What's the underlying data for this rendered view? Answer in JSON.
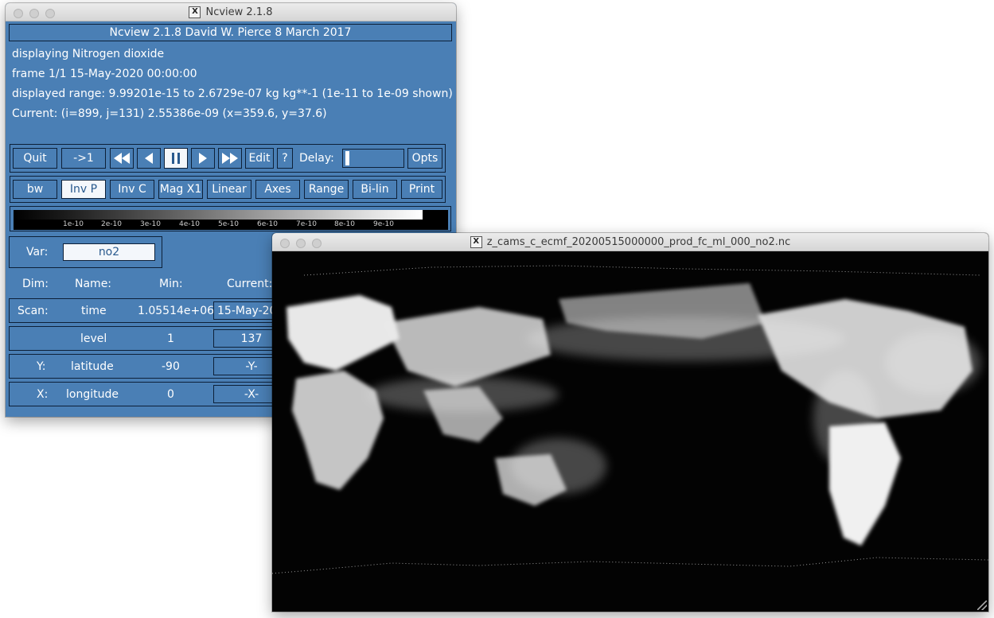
{
  "ncview_window": {
    "title": "Ncview 2.1.8",
    "header": "Ncview 2.1.8 David W. Pierce  8 March 2017",
    "displaying": "displaying Nitrogen dioxide",
    "frame": "frame 1/1 15-May-2020 00:00:00",
    "range": "displayed range: 9.99201e-15 to 2.6729e-07 kg kg**-1 (1e-11 to 1e-09 shown)",
    "current": "Current: (i=899, j=131) 2.55386e-09 (x=359.6, y=37.6)",
    "toolbar": {
      "quit": "Quit",
      "to_first": "->1",
      "rewind_icon": "fast-backward-icon",
      "back_icon": "step-backward-icon",
      "pause_icon": "pause-icon",
      "forward_icon": "step-forward-icon",
      "fastforward_icon": "fast-forward-icon",
      "edit": "Edit",
      "help": "?",
      "delay_label": "Delay:",
      "opts": "Opts"
    },
    "options": {
      "bw": "bw",
      "inv_p": "Inv P",
      "inv_c": "Inv C",
      "mag": "Mag X1",
      "linear": "Linear",
      "axes": "Axes",
      "range": "Range",
      "interp": "Bi-lin",
      "print": "Print"
    },
    "colorbar_ticks": [
      "1e-10",
      "2e-10",
      "3e-10",
      "4e-10",
      "5e-10",
      "6e-10",
      "7e-10",
      "8e-10",
      "9e-10"
    ],
    "var": {
      "label": "Var:",
      "value": "no2"
    },
    "dim_headers": {
      "dim": "Dim:",
      "name": "Name:",
      "min": "Min:",
      "current": "Current:"
    },
    "dims": [
      {
        "role": "Scan:",
        "name": "time",
        "min": "1.05514e+06",
        "current": "15-May-20"
      },
      {
        "role": "",
        "name": "level",
        "min": "1",
        "current": "137"
      },
      {
        "role": "Y:",
        "name": "latitude",
        "min": "-90",
        "current": "-Y-"
      },
      {
        "role": "X:",
        "name": "longitude",
        "min": "0",
        "current": "-X-"
      }
    ]
  },
  "image_window": {
    "title": "z_cams_c_ecmf_20200515000000_prod_fc_ml_000_no2.nc"
  },
  "colors": {
    "panel": "#4a7fb5",
    "border": "#0d2038",
    "highlight": "#f4f7fb"
  }
}
